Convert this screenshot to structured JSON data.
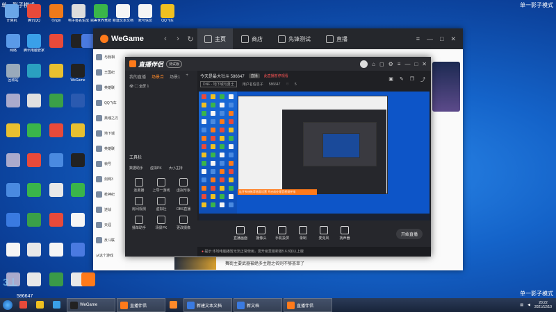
{
  "corner_left": "单一影子模式",
  "corner_right": "单一影子模式",
  "corner_right_bottom": "单一影子模式",
  "watermark_number": "586647",
  "desktop": {
    "icons": [
      {
        "label": "计算机",
        "color": "#6aa6e8"
      },
      {
        "label": "腾讯QQ",
        "color": "#e84a3a"
      },
      {
        "label": "Origin",
        "color": "#f07a1a"
      },
      {
        "label": "电子签名生成器",
        "color": "#ddd"
      },
      {
        "label": "完美世界竞技",
        "color": "#3ab54a"
      },
      {
        "label": "新建文本文档",
        "color": "#f5f5f5"
      },
      {
        "label": "账号信息",
        "color": "#f5f5f5"
      },
      {
        "label": "QQ飞车",
        "color": "#f0c020"
      },
      {
        "label": "网络",
        "color": "#5a9ae8"
      },
      {
        "label": "腾讯电脑管家",
        "color": "#3aa0e8"
      },
      {
        "label": "",
        "color": "#e84a3a"
      },
      {
        "label": "",
        "color": "#222"
      },
      {
        "label": "",
        "color": "#4a7ae0"
      },
      {
        "label": "",
        "color": "#ff7a1a"
      },
      {
        "label": "回收站",
        "color": "#9ab"
      },
      {
        "label": "",
        "color": "#2aa0c0"
      },
      {
        "label": "",
        "color": "#e8c030"
      },
      {
        "label": "WeGame",
        "color": "#222"
      },
      {
        "label": "",
        "color": "#aac"
      },
      {
        "label": "",
        "color": "#e0e0e0"
      },
      {
        "label": "",
        "color": "#3aa048"
      },
      {
        "label": "",
        "color": "#2a5ab0"
      },
      {
        "label": "",
        "color": "#e8c030"
      },
      {
        "label": "",
        "color": "#3ab54a"
      },
      {
        "label": "",
        "color": "#e84a3a"
      },
      {
        "label": "",
        "color": "#e8c030"
      },
      {
        "label": "",
        "color": "#aac"
      },
      {
        "label": "",
        "color": "#e84a3a"
      },
      {
        "label": "",
        "color": "#4a8ae0"
      },
      {
        "label": "",
        "color": "#222"
      },
      {
        "label": "",
        "color": "#4a8ae0"
      },
      {
        "label": "",
        "color": "#3ab54a"
      },
      {
        "label": "",
        "color": "#e8e8e8"
      },
      {
        "label": "",
        "color": "#3ab54a"
      },
      {
        "label": "",
        "color": "#3a7ae0"
      },
      {
        "label": "",
        "color": "#3aa048"
      },
      {
        "label": "",
        "color": "#e84a3a"
      },
      {
        "label": "",
        "color": "#f5f5f5"
      },
      {
        "label": "",
        "color": "#f5f5f5"
      },
      {
        "label": "",
        "color": "#e8e8e8"
      },
      {
        "label": "",
        "color": "#f5f5f5"
      },
      {
        "label": "",
        "color": "#4a7ae0"
      },
      {
        "label": "",
        "color": "#aac"
      },
      {
        "label": "",
        "color": "#e8e8e8"
      },
      {
        "label": "",
        "color": "#3a9a48"
      },
      {
        "label": "",
        "color": "#e8e8e8"
      },
      {
        "label": "",
        "color": "#ff7a1a"
      }
    ]
  },
  "wegame": {
    "logo": "WeGame",
    "tabs": [
      {
        "label": "主页",
        "active": true
      },
      {
        "label": "商店",
        "active": false
      },
      {
        "label": "先锋测试",
        "active": false
      },
      {
        "label": "直播",
        "active": false
      }
    ],
    "sidebar": [
      "与我相",
      "王国纪",
      "英雄联",
      "QQ飞车",
      "英魂之刃",
      "地下城",
      "英雄联",
      "帧号",
      "剑网3",
      "枪神纪",
      "逆战",
      "天涯",
      "反斗联"
    ],
    "banner_text": "舞街主要武器被绝多主题之名则不够荟萃了",
    "bottom_label": "从这个游戏"
  },
  "live": {
    "brand": "直播伴侣",
    "version": "测试版",
    "left_tabs": [
      "我的直播",
      "场景合",
      "场景1"
    ],
    "scene": "全屏 1",
    "tools_title": "工具栏",
    "tool_row1": [
      "数据助手",
      "虚拟PK",
      "大小主持"
    ],
    "tools": [
      "连麦播",
      "上导一游戏",
      "虚拟形象",
      "房间观测",
      "虚拟社",
      "OBS直播",
      "播单助手",
      "场景PK",
      "更改摄像"
    ],
    "room_title": "今天是最大社斗 586647",
    "room_tag": "直播",
    "room_warn": "此直播暂停观看",
    "meta_category": "DNF - 地下城与勇士",
    "meta_user": "用户名信息子",
    "meta_id": "586647",
    "meta_count": "5",
    "bottom_buttons": [
      "直播画面",
      "摄像头",
      "手机投屏",
      "录制",
      "麦克风",
      "扬声器"
    ],
    "live_button": "开始直播",
    "status_text": "提示:本地电脑播暂无法正常使用，需升级至最新版5.6.8加以上版",
    "preview_tip": "连开系统推荐画面设置    开启前处理音视频并排"
  },
  "taskbar": {
    "items": [
      {
        "label": "",
        "color": "#e84a3a"
      },
      {
        "label": "",
        "color": "#f0c020"
      },
      {
        "label": "",
        "color": "#3aa0e8"
      },
      {
        "label": "WeGame",
        "color": "#222"
      },
      {
        "label": "直播伴侣",
        "color": "#ff7a1a"
      },
      {
        "label": "",
        "color": "#ff8a2a"
      },
      {
        "label": "新建文本文档",
        "color": "#3a7ae0"
      },
      {
        "label": "新文档",
        "color": "#3a7ae0"
      },
      {
        "label": "直播伴侣",
        "color": "#ff7a1a"
      }
    ],
    "clock_time": "20:22",
    "clock_date": "2021/12/10"
  }
}
